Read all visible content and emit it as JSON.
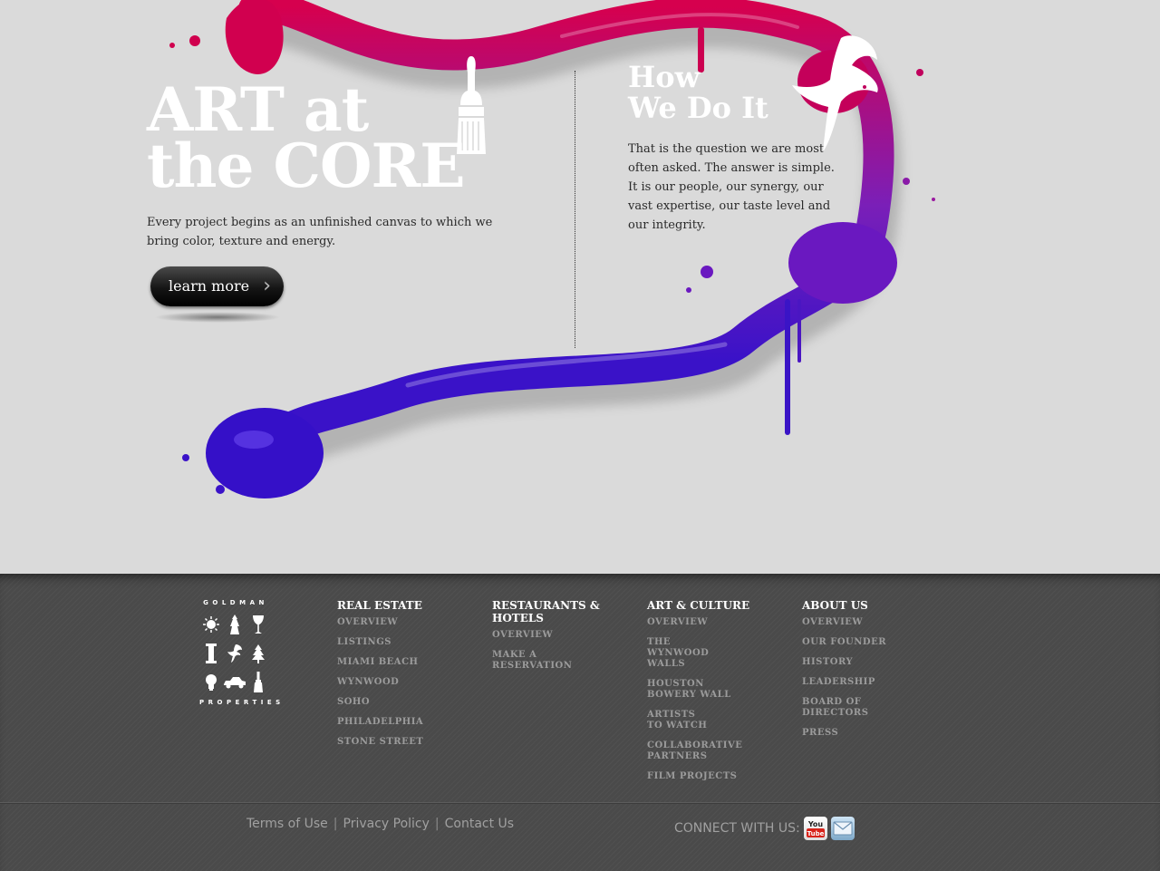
{
  "hero": {
    "title_line1": "ART at",
    "title_line2": "the CORE",
    "intro": "Every project begins as an unfinished canvas to which we bring color, texture and energy.",
    "cta_label": "learn more",
    "side_title_line1": "How",
    "side_title_line2": "We Do It",
    "side_text": "That is the question we are most often asked. The answer is simple. It is our people, our synergy, our vast expertise, our taste level and our integrity."
  },
  "colors": {
    "paint_top": "#d6004e",
    "paint_mid": "#7a1fb8",
    "paint_bottom": "#3a12c8",
    "background": "#dadada",
    "footer": "#4a4a4a"
  },
  "logo": {
    "top": "GOLDMAN",
    "bottom": "PROPERTIES",
    "icons": [
      "sun-icon",
      "figure-icon",
      "wine-glass-icon",
      "column-icon",
      "bird-icon",
      "tree-icon",
      "lightbulb-icon",
      "car-icon",
      "paintbrush-icon"
    ]
  },
  "footer_nav": [
    {
      "heading": "REAL ESTATE",
      "items": [
        "OVERVIEW",
        "LISTINGS",
        "MIAMI BEACH",
        "WYNWOOD",
        "SOHO",
        "PHILADELPHIA",
        "STONE STREET"
      ]
    },
    {
      "heading": "RESTAURANTS & HOTELS",
      "items": [
        "OVERVIEW",
        "MAKE A RESERVATION"
      ]
    },
    {
      "heading": "ART & CULTURE",
      "items": [
        "OVERVIEW",
        "THE WYNWOOD WALLS",
        "HOUSTON BOWERY WALL",
        "ARTISTS TO WATCH",
        "COLLABORATIVE PARTNERS",
        "FILM PROJECTS"
      ]
    },
    {
      "heading": "ABOUT US",
      "items": [
        "OVERVIEW",
        "OUR FOUNDER",
        "HISTORY",
        "LEADERSHIP",
        "BOARD OF DIRECTORS",
        "PRESS"
      ]
    }
  ],
  "legal": {
    "terms": "Terms of Use",
    "privacy": "Privacy Policy",
    "contact": "Contact Us",
    "separator": "|"
  },
  "social": {
    "label": "CONNECT WITH US:",
    "youtube_text_1": "You",
    "youtube_text_2": "Tube",
    "icons": [
      "youtube-icon",
      "email-icon"
    ]
  }
}
